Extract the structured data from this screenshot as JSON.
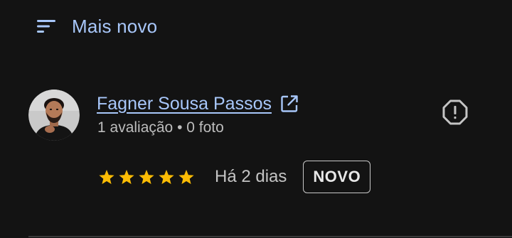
{
  "sort": {
    "label": "Mais novo",
    "icon": "sort-icon",
    "accent_color": "#a8c7fa"
  },
  "review": {
    "author": {
      "name": "Fagner Sousa Passos",
      "meta": "1 avaliação • 0 foto",
      "avatar_icon": "avatar-photo",
      "external_icon": "open-in-new-icon"
    },
    "rating": {
      "stars": 5,
      "max_stars": 5,
      "star_color": "#fbbc04"
    },
    "time": "Há 2 dias",
    "badge": "NOVO",
    "report_icon": "report-icon"
  }
}
